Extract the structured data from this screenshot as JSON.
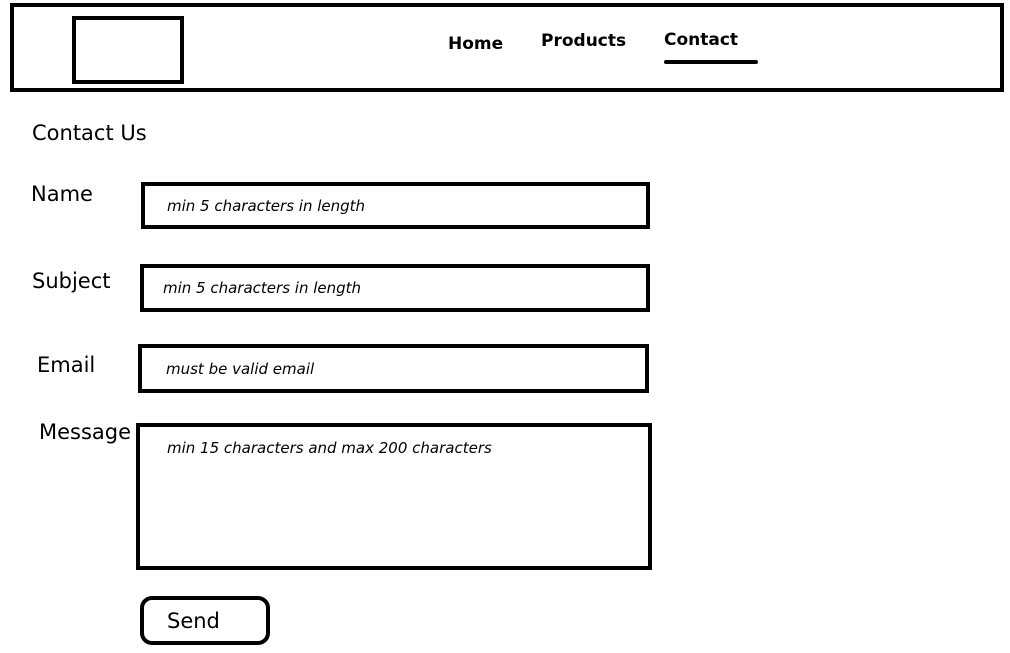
{
  "nav": {
    "items": [
      {
        "label": "Home"
      },
      {
        "label": "Products"
      },
      {
        "label": "Contact",
        "active": true
      }
    ]
  },
  "page": {
    "title": "Contact Us"
  },
  "form": {
    "name": {
      "label": "Name",
      "placeholder": "min 5 characters in length"
    },
    "subject": {
      "label": "Subject",
      "placeholder": "min 5 characters in length"
    },
    "email": {
      "label": "Email",
      "placeholder": "must be valid email"
    },
    "message": {
      "label": "Message",
      "placeholder": "min 15 characters and max 200 characters"
    },
    "send_label": "Send"
  }
}
